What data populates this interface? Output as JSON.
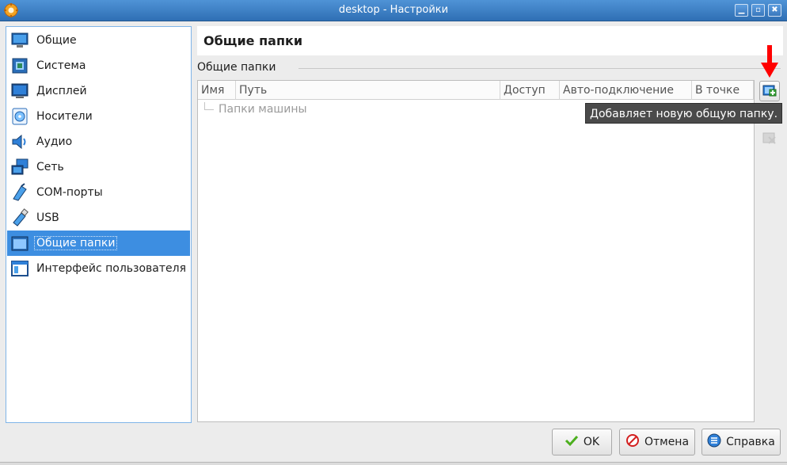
{
  "window": {
    "title": "desktop - Настройки",
    "icon": "gear-icon",
    "controls": [
      "minimize-icon",
      "maximize-icon",
      "close-icon"
    ]
  },
  "sidebar": {
    "items": [
      {
        "label": "Общие",
        "icon": "general-monitor-icon",
        "selected": false
      },
      {
        "label": "Система",
        "icon": "system-chip-icon",
        "selected": false
      },
      {
        "label": "Дисплей",
        "icon": "display-icon",
        "selected": false
      },
      {
        "label": "Носители",
        "icon": "storage-disc-icon",
        "selected": false
      },
      {
        "label": "Аудио",
        "icon": "audio-speaker-icon",
        "selected": false
      },
      {
        "label": "Сеть",
        "icon": "network-icon",
        "selected": false
      },
      {
        "label": "COM-порты",
        "icon": "serial-port-icon",
        "selected": false
      },
      {
        "label": "USB",
        "icon": "usb-icon",
        "selected": false
      },
      {
        "label": "Общие папки",
        "icon": "shared-folder-icon",
        "selected": true
      },
      {
        "label": "Интерфейс пользователя",
        "icon": "user-interface-icon",
        "selected": false
      }
    ]
  },
  "page": {
    "title": "Общие папки",
    "group_label": "Общие папки"
  },
  "table": {
    "columns": [
      "Имя",
      "Путь",
      "Доступ",
      "Авто-подключение",
      "В точке"
    ],
    "rows": [
      {
        "label": "Папки машины"
      }
    ]
  },
  "toolbar": {
    "add_icon": "add-folder-icon",
    "edit_icon": "edit-folder-icon",
    "remove_icon": "remove-folder-icon"
  },
  "tooltip": {
    "text": "Добавляет новую общую папку."
  },
  "annotation": {
    "arrow_color": "#ff0000"
  },
  "buttons": {
    "ok": "OK",
    "cancel": "Отмена",
    "help": "Справка"
  },
  "colors": {
    "selection": "#3d8ee1",
    "titlebar": "#3a7fc4"
  }
}
